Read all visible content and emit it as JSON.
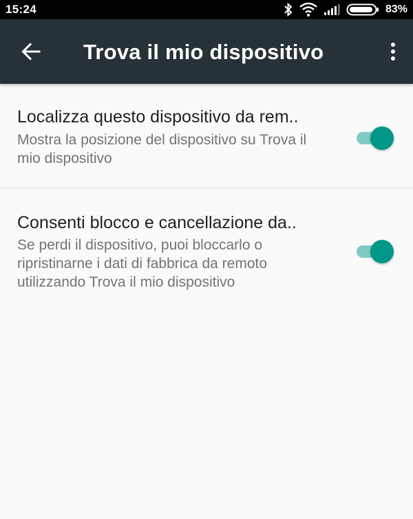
{
  "status_bar": {
    "time": "15:24",
    "battery_percent": "83%",
    "icons": [
      "bluetooth-icon",
      "wifi-icon",
      "signal-icon",
      "battery-icon"
    ]
  },
  "app_bar": {
    "title": "Trova il mio dispositivo",
    "background_color": "#263238",
    "icons": [
      "back-arrow-icon",
      "more-vert-icon"
    ]
  },
  "settings": [
    {
      "title": "Localizza questo dispositivo da rem..",
      "summary": "Mostra la posizione del dispositivo su Trova il mio dispositivo",
      "enabled": true
    },
    {
      "title": "Consenti blocco e cancellazione da..",
      "summary": "Se perdi il dispositivo, puoi bloccarlo o ripristinarne i dati di fabbrica da remoto utilizzando Trova il mio dispositivo",
      "enabled": true
    }
  ],
  "colors": {
    "accent": "#009688",
    "accent_track": "#80cbc4"
  }
}
